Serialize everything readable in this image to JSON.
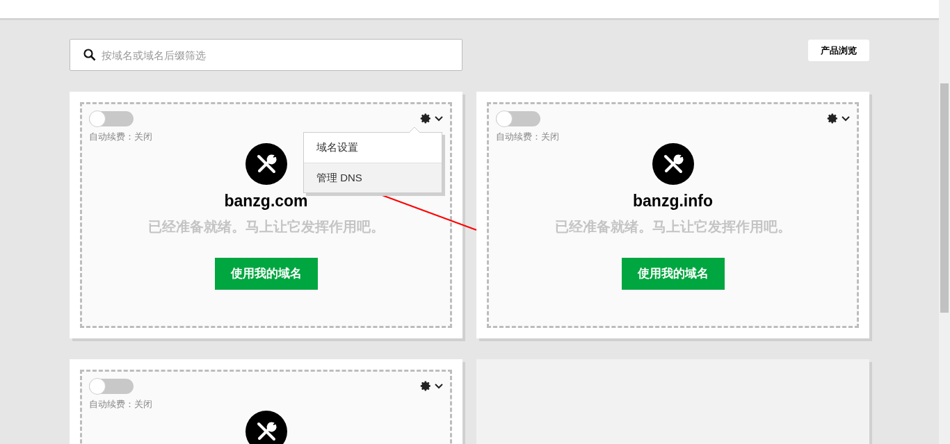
{
  "search": {
    "placeholder": "按域名或域名后缀筛选"
  },
  "product_button": "产品浏览",
  "cards": [
    {
      "auto_renew": {
        "on": false,
        "label": "自动续费：关闭"
      },
      "domain": "banzg.com",
      "subtitle": "已经准备就绪。马上让它发挥作用吧。",
      "action": "使用我的域名",
      "menu": {
        "items": [
          {
            "label": "域名设置",
            "selected": false
          },
          {
            "label": "管理 DNS",
            "selected": true
          }
        ]
      }
    },
    {
      "auto_renew": {
        "on": false,
        "label": "自动续费：关闭"
      },
      "domain": "banzg.info",
      "subtitle": "已经准备就绪。马上让它发挥作用吧。",
      "action": "使用我的域名"
    },
    {
      "auto_renew": {
        "on": false,
        "label": "自动续费：关闭"
      }
    },
    {
      "kind": "empty"
    }
  ]
}
